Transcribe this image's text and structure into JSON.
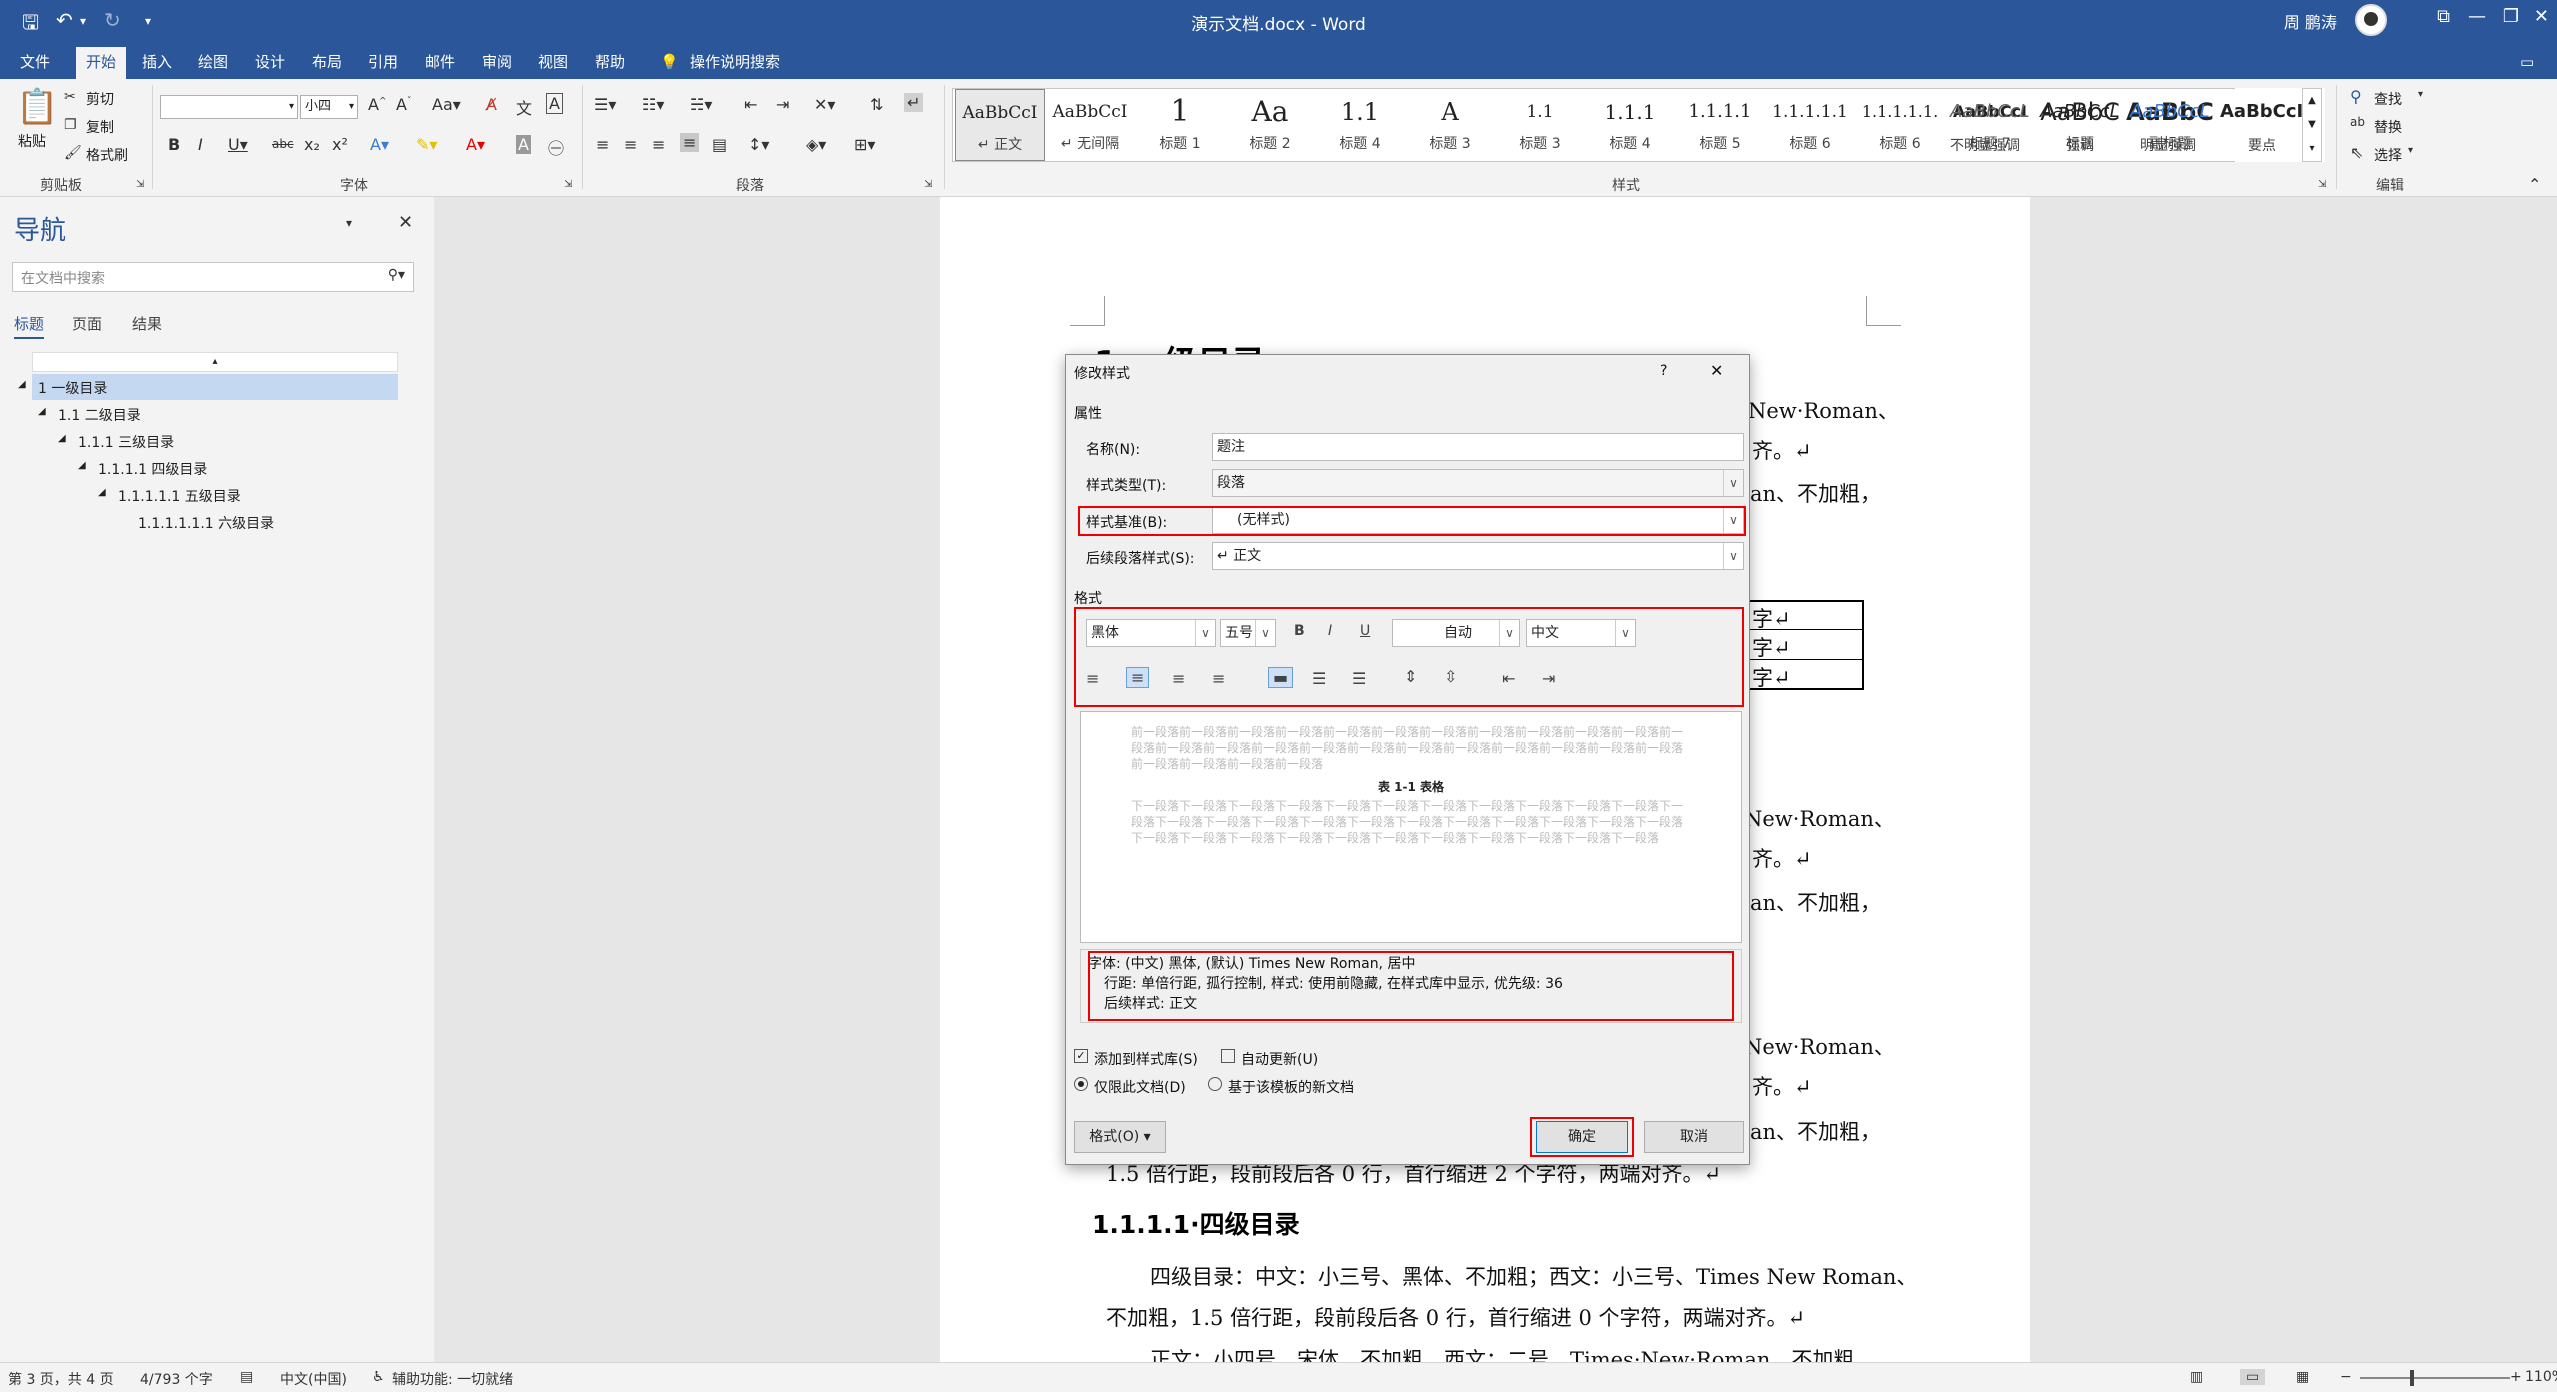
{
  "window": {
    "title": "演示文档.docx - Word",
    "user": "周 鹏涛"
  },
  "tabs": [
    "文件",
    "开始",
    "插入",
    "绘图",
    "设计",
    "布局",
    "引用",
    "邮件",
    "审阅",
    "视图",
    "帮助"
  ],
  "tell_me": "操作说明搜索",
  "clipboard": {
    "paste": "粘贴",
    "cut": "剪切",
    "copy": "复制",
    "format_painter": "格式刷",
    "label": "剪贴板"
  },
  "font_group": {
    "font_size": "小四",
    "label": "字体"
  },
  "paragraph_group": {
    "label": "段落"
  },
  "styles_group": {
    "label": "样式",
    "items": [
      {
        "preview": "AaBbCcI",
        "name": "↵ 正文"
      },
      {
        "preview": "AaBbCcI",
        "name": "↵ 无间隔"
      },
      {
        "preview": "1",
        "name": "标题 1"
      },
      {
        "preview": "Aa",
        "name": "标题 2"
      },
      {
        "preview": "1.1",
        "name": "标题 3"
      },
      {
        "preview": "A",
        "name": "标题 4"
      },
      {
        "preview": "1.1.1",
        "name": "标题 4"
      },
      {
        "preview": "1.1.1.1",
        "name": "标题 5"
      },
      {
        "preview": "1.1.1.1.1",
        "name": "标题 6"
      },
      {
        "preview": "1.1.1.1.1.",
        "name": "标题 6"
      },
      {
        "preview": "AaBbCcI",
        "name": "标题 7"
      },
      {
        "preview": "AaBbC",
        "name": "标题"
      },
      {
        "preview": "AaBbC",
        "name": "副标题"
      },
      {
        "preview": "AaBbCcL",
        "name": "不明显强调"
      },
      {
        "preview": "AaBbCcL",
        "name": "强调"
      },
      {
        "preview": "AaBbCcL",
        "name": "明显强调"
      },
      {
        "preview": "AaBbCcI",
        "name": "要点"
      }
    ]
  },
  "editing_group": {
    "find": "查找",
    "replace": "替换",
    "select": "选择",
    "label": "编辑"
  },
  "nav": {
    "title": "导航",
    "search_placeholder": "在文档中搜索",
    "tabs": [
      "标题",
      "页面",
      "结果"
    ],
    "items": [
      "1 一级目录",
      "1.1 二级目录",
      "1.1.1 三级目录",
      "1.1.1.1 四级目录",
      "1.1.1.1.1 五级目录",
      "1.1.1.1.1.1 六级目录"
    ]
  },
  "document": {
    "heading1": "1 一级目录",
    "frag": [
      "New·Roman、",
      "齐。↵",
      "an、不加粗，",
      "字↵",
      "字↵",
      "字↵",
      "New·Roman、",
      "齐。↵",
      "an、不加粗，",
      "New·Roman、",
      "齐。↵",
      "an、不加粗，"
    ],
    "line_15": "1.5 倍行距，段前段后各 0 行，首行缩进 2 个字符，两端对齐。↵",
    "heading4": "1.1.1.1·四级目录",
    "p4a": "四级目录：中文：小三号、黑体、不加粗；西文：小三号、Times New Roman、",
    "p4b": "不加粗，1.5 倍行距，段前段后各 0 行，首行缩进 0 个字符，两端对齐。↵",
    "p5": "正文：小四号、宋体、不加粗，西文：二号、Times·New·Roman、不加粗、"
  },
  "dialog": {
    "title": "修改样式",
    "help": "?",
    "props_label": "属性",
    "name_label": "名称(N):",
    "name_value": "题注",
    "type_label": "样式类型(T):",
    "type_value": "段落",
    "based_label": "样式基准(B):",
    "based_value": "(无样式)",
    "next_label": "后续段落样式(S):",
    "next_value": "↵ 正文",
    "format_label": "格式",
    "font": "黑体",
    "size": "五号",
    "bold": "B",
    "italic": "I",
    "underline": "U",
    "color": "自动",
    "lang": "中文",
    "preview_prev": "前一段落前一段落前一段落前一段落前一段落前一段落前一段落前一段落前一段落前一段落前一段落前一段落前一段落前一段落前一段落前一段落前一段落前一段落前一段落前一段落前一段落前一段落前一段落前一段落前一段落前一段落前一段落",
    "preview_caption": "表 1-1  表格",
    "preview_next": "下一段落下一段落下一段落下一段落下一段落下一段落下一段落下一段落下一段落下一段落下一段落下一段落下一段落下一段落下一段落下一段落下一段落下一段落下一段落下一段落下一段落下一段落下一段落下一段落下一段落下一段落下一段落下一段落下一段落下一段落下一段落下一段落下一段落下一段落",
    "desc1": "字体: (中文) 黑体, (默认) Times New Roman, 居中",
    "desc2": "行距: 单倍行距, 孤行控制, 样式: 使用前隐藏, 在样式库中显示, 优先级: 36",
    "desc3": "后续样式: 正文",
    "add_gallery": "添加到样式库(S)",
    "auto_update": "自动更新(U)",
    "only_doc": "仅限此文档(D)",
    "template": "基于该模板的新文档",
    "format_btn": "格式(O) ▾",
    "ok": "确定",
    "cancel": "取消"
  },
  "status": {
    "page": "第 3 页，共 4 页",
    "words": "4/793 个字",
    "lang": "中文(中国)",
    "accessibility": "辅助功能: 一切就绪",
    "zoom": "110%"
  }
}
